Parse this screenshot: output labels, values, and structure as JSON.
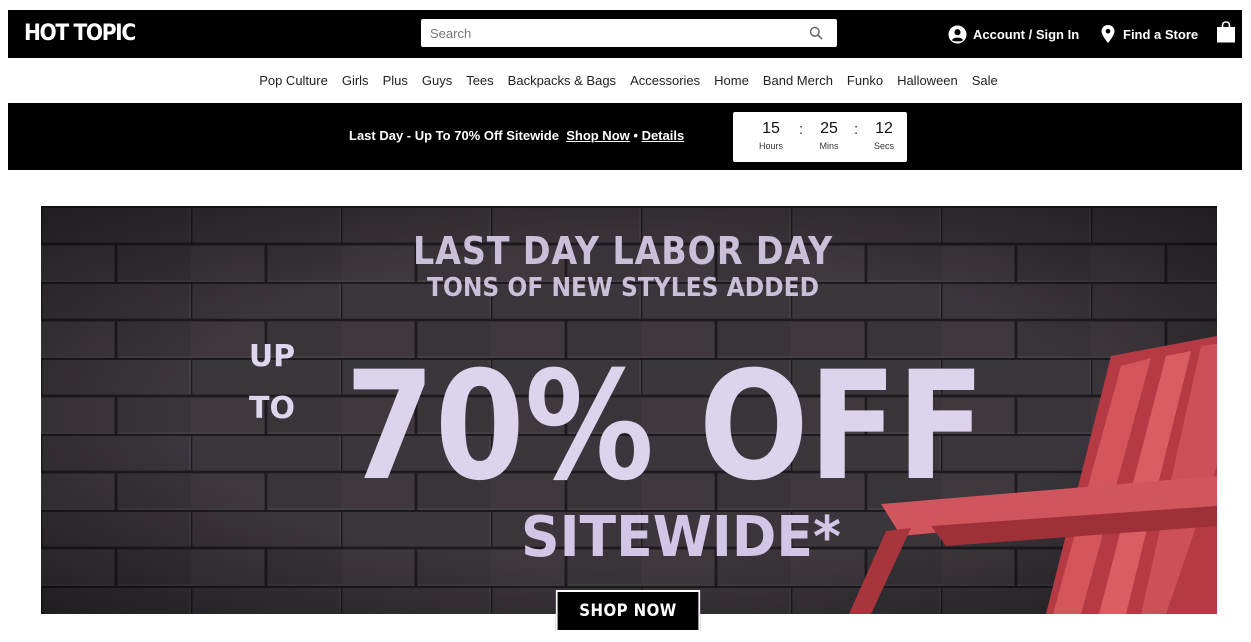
{
  "header": {
    "logo": "HOT TOPIC",
    "search_placeholder": "Search",
    "account_label": "Account / Sign In",
    "store_label": "Find a Store"
  },
  "nav": {
    "items": [
      "Pop Culture",
      "Girls",
      "Plus",
      "Guys",
      "Tees",
      "Backpacks & Bags",
      "Accessories",
      "Home",
      "Band Merch",
      "Funko",
      "Halloween",
      "Sale"
    ]
  },
  "promo": {
    "text": "Last Day - Up To 70% Off Sitewide",
    "shop_now": "Shop Now",
    "separator": "•",
    "details": "Details",
    "countdown": {
      "hours": "15",
      "hours_label": "Hours",
      "mins": "25",
      "mins_label": "Mins",
      "secs": "12",
      "secs_label": "Secs",
      "sep": ":"
    }
  },
  "hero": {
    "line1": "LAST DAY LABOR DAY",
    "line2": "TONS OF NEW STYLES ADDED",
    "up": "UP",
    "to": "TO",
    "big": "70% OFF",
    "sitewide": "SITEWIDE*",
    "button": "SHOP NOW"
  },
  "colors": {
    "brand_black": "#000000",
    "hero_text": "#d8cfe6",
    "chair_red": "#c9434a",
    "brick": "#3a3539"
  }
}
